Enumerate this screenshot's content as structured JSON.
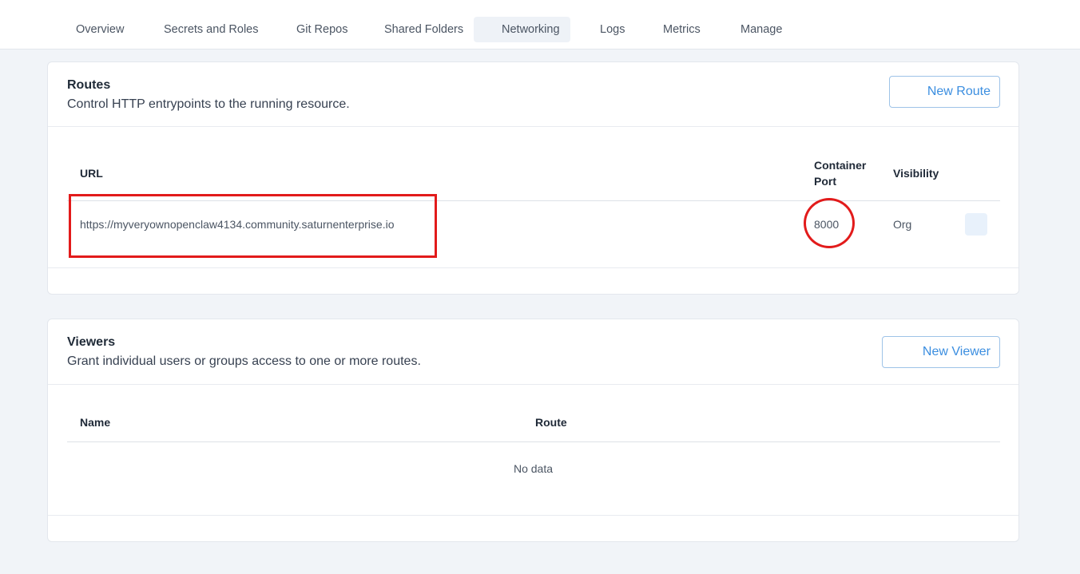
{
  "tabs": [
    {
      "label": "Overview"
    },
    {
      "label": "Secrets and Roles"
    },
    {
      "label": "Git Repos"
    },
    {
      "label": "Shared Folders"
    },
    {
      "label": "Networking",
      "active": true
    },
    {
      "label": "Logs"
    },
    {
      "label": "Metrics"
    },
    {
      "label": "Manage"
    }
  ],
  "routes": {
    "title": "Routes",
    "subtitle": "Control HTTP entrypoints to the running resource.",
    "new_button": "New Route",
    "columns": {
      "url": "URL",
      "container_port_line1": "Container",
      "container_port_line2": "Port",
      "visibility": "Visibility"
    },
    "rows": [
      {
        "url": "https://myveryownopenclaw4134.community.saturnenterprise.io",
        "port": "8000",
        "visibility": "Org"
      }
    ]
  },
  "viewers": {
    "title": "Viewers",
    "subtitle": "Grant individual users or groups access to one or more routes.",
    "new_button": "New Viewer",
    "columns": {
      "name": "Name",
      "route": "Route"
    },
    "empty_text": "No data"
  },
  "colors": {
    "accent": "#3b8ee0",
    "annotation": "#e21b1b",
    "page_bg": "#f1f4f8"
  }
}
